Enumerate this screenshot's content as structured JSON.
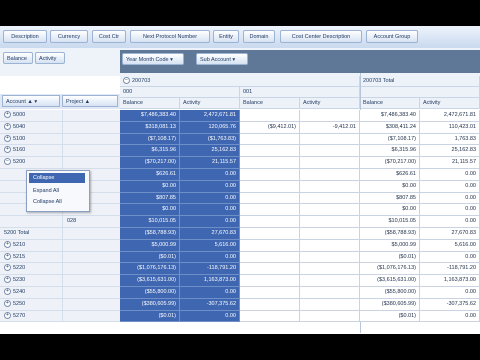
{
  "field_bar": [
    "Description",
    "Currency",
    "Cost Ctr",
    "Next Protocol Number",
    "Entity",
    "Domain",
    "Cost Center Description",
    "Account Group"
  ],
  "filter_bar": {
    "balance": "Balance",
    "activity": "Activity",
    "year_month": "Year Month Code",
    "sub_account": "Sub Account"
  },
  "col_headers": {
    "period": "200703",
    "period_total": "200703 Total",
    "sub_000": "000",
    "sub_001": "001",
    "balance": "Balance",
    "activity": "Activity"
  },
  "row_headers": {
    "account": "Account",
    "project": "Project"
  },
  "rows": [
    {
      "account": "5000",
      "project": "",
      "b000": "$7,486,383.40",
      "a000": "2,472,671.81",
      "b001": "",
      "a001": "",
      "bt": "$7,486,383.40",
      "at": "2,472,671.81"
    },
    {
      "account": "5040",
      "project": "",
      "b000": "$318,081.13",
      "a000": "120,065.76",
      "b001": "($9,412.01)",
      "a001": "-9,412.01",
      "bt": "$308,411.24",
      "at": "110,423.01"
    },
    {
      "account": "5100",
      "project": "",
      "b000": "($7,108.17)",
      "a000": "($1,763.83)",
      "b001": "",
      "a001": "",
      "bt": "($7,108.17)",
      "at": "1,763.83"
    },
    {
      "account": "5160",
      "project": "",
      "b000": "$6,315.96",
      "a000": "25,162.83",
      "b001": "",
      "a001": "",
      "bt": "$6,315.96",
      "at": "25,162.83"
    },
    {
      "account": "5200",
      "project": "",
      "b000": "($70,217.00)",
      "a000": "21,115.57",
      "b001": "",
      "a001": "",
      "bt": "($70,217.00)",
      "at": "21,115.57"
    },
    {
      "account": "",
      "project": "",
      "b000": "$626.61",
      "a000": "0.00",
      "b001": "",
      "a001": "",
      "bt": "$626.61",
      "at": "0.00"
    },
    {
      "account": "",
      "project": "",
      "b000": "$0.00",
      "a000": "0.00",
      "b001": "",
      "a001": "",
      "bt": "$0.00",
      "at": "0.00"
    },
    {
      "account": "",
      "project": "",
      "b000": "$807.85",
      "a000": "0.00",
      "b001": "",
      "a001": "",
      "bt": "$807.85",
      "at": "0.00"
    },
    {
      "account": "",
      "project": "028",
      "b000": "$0.00",
      "a000": "0.00",
      "b001": "",
      "a001": "",
      "bt": "$0.00",
      "at": "0.00"
    },
    {
      "account": "",
      "project": "028",
      "b000": "$10,015.05",
      "a000": "0.00",
      "b001": "",
      "a001": "",
      "bt": "$10,015.05",
      "at": "0.00"
    },
    {
      "account": "5200 Total",
      "project": "",
      "b000": "($58,788.93)",
      "a000": "27,670.83",
      "b001": "",
      "a001": "",
      "bt": "($58,788.93)",
      "at": "27,670.83"
    },
    {
      "account": "5210",
      "project": "",
      "b000": "$5,000.99",
      "a000": "5,616.00",
      "b001": "",
      "a001": "",
      "bt": "$5,000.99",
      "at": "5,616.00"
    },
    {
      "account": "5215",
      "project": "",
      "b000": "($0.01)",
      "a000": "0.00",
      "b001": "",
      "a001": "",
      "bt": "($0.01)",
      "at": "0.00"
    },
    {
      "account": "5220",
      "project": "",
      "b000": "($1,076,176.13)",
      "a000": "-118,791.20",
      "b001": "",
      "a001": "",
      "bt": "($1,076,176.13)",
      "at": "-118,791.20"
    },
    {
      "account": "5230",
      "project": "",
      "b000": "($3,615,631.00)",
      "a000": "1,163,873.00",
      "b001": "",
      "a001": "",
      "bt": "($3,615,631.00)",
      "at": "1,163,873.00"
    },
    {
      "account": "5240",
      "project": "",
      "b000": "($55,800.00)",
      "a000": "0.00",
      "b001": "",
      "a001": "",
      "bt": "($55,800.00)",
      "at": "0.00"
    },
    {
      "account": "5250",
      "project": "",
      "b000": "($380,605.99)",
      "a000": "-307,375.62",
      "b001": "",
      "a001": "",
      "bt": "($380,605.99)",
      "at": "-307,375.62"
    },
    {
      "account": "5270",
      "project": "",
      "b000": "($0.01)",
      "a000": "0.00",
      "b001": "",
      "a001": "",
      "bt": "($0.01)",
      "at": "0.00"
    }
  ],
  "context_menu": [
    "Collapse",
    "Expand All",
    "Collapse All"
  ]
}
